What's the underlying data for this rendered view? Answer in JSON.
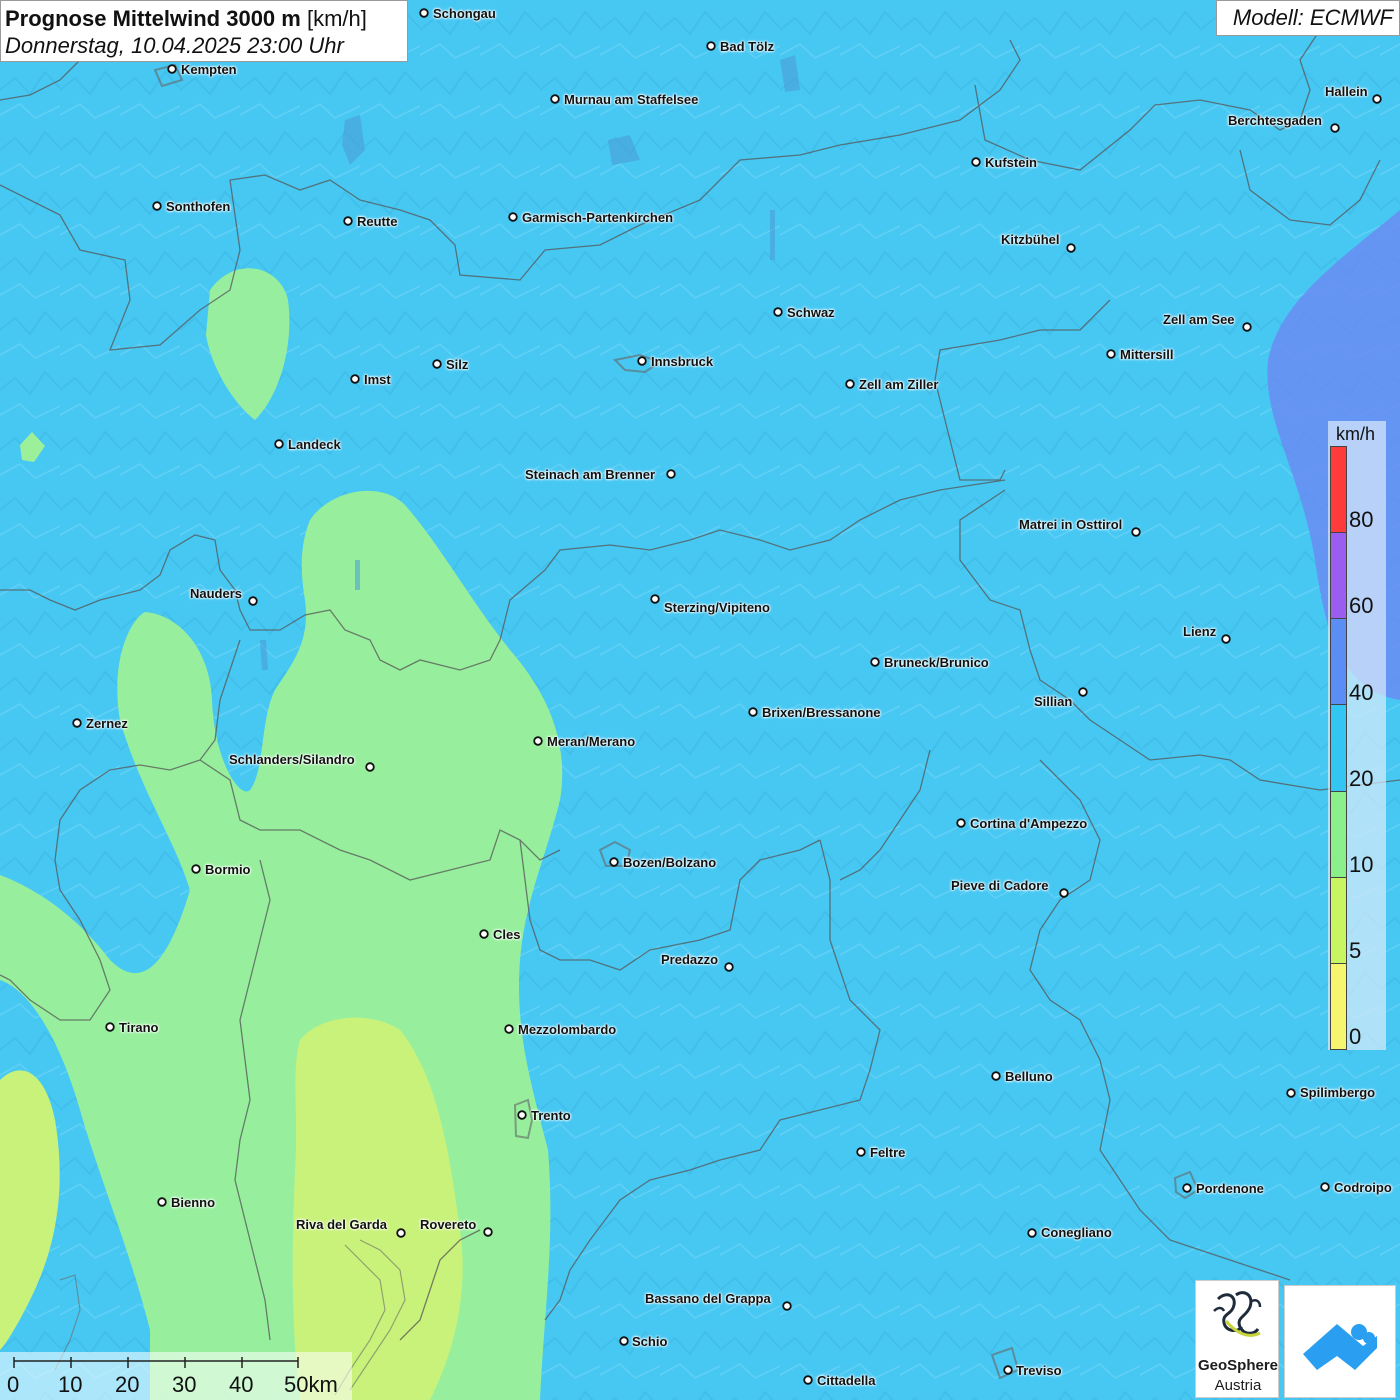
{
  "title": {
    "main": "Prognose Mittelwind 3000 m",
    "unit": "[km/h]",
    "datetime": "Donnerstag, 10.04.2025 23:00 Uhr"
  },
  "model": "Modell: ECMWF",
  "places": [
    {
      "name": "Schongau"
    },
    {
      "name": "Bad Tölz"
    },
    {
      "name": "Kempten"
    },
    {
      "name": "Murnau am Staffelsee"
    },
    {
      "name": "Hallein"
    },
    {
      "name": "Berchtesgaden"
    },
    {
      "name": "Kufstein"
    },
    {
      "name": "Sonthofen"
    },
    {
      "name": "Reutte"
    },
    {
      "name": "Garmisch-Partenkirchen"
    },
    {
      "name": "Kitzbühel"
    },
    {
      "name": "Schwaz"
    },
    {
      "name": "Zell am See"
    },
    {
      "name": "Innsbruck"
    },
    {
      "name": "Mittersill"
    },
    {
      "name": "Imst"
    },
    {
      "name": "Silz"
    },
    {
      "name": "Zell am Ziller"
    },
    {
      "name": "Landeck"
    },
    {
      "name": "Steinach am Brenner"
    },
    {
      "name": "Matrei in Osttirol"
    },
    {
      "name": "Nauders"
    },
    {
      "name": "Sterzing/Vipiteno"
    },
    {
      "name": "Lienz"
    },
    {
      "name": "Bruneck/Brunico"
    },
    {
      "name": "Sillian"
    },
    {
      "name": "Brixen/Bressanone"
    },
    {
      "name": "Zernez"
    },
    {
      "name": "Meran/Merano"
    },
    {
      "name": "Schlanders/Silandro"
    },
    {
      "name": "Cortina d'Ampezzo"
    },
    {
      "name": "Bozen/Bolzano"
    },
    {
      "name": "Bormio"
    },
    {
      "name": "Pieve di Cadore"
    },
    {
      "name": "Cles"
    },
    {
      "name": "Predazzo"
    },
    {
      "name": "Tirano"
    },
    {
      "name": "Mezzolombardo"
    },
    {
      "name": "Belluno"
    },
    {
      "name": "Spilimbergo"
    },
    {
      "name": "Trento"
    },
    {
      "name": "Feltre"
    },
    {
      "name": "Pordenone"
    },
    {
      "name": "Codroipo"
    },
    {
      "name": "Bienno"
    },
    {
      "name": "Riva del Garda"
    },
    {
      "name": "Rovereto"
    },
    {
      "name": "Conegliano"
    },
    {
      "name": "Bassano del Grappa"
    },
    {
      "name": "Schio"
    },
    {
      "name": "Treviso"
    },
    {
      "name": "Cittadella"
    }
  ],
  "legend": {
    "unit": "km/h",
    "labels": [
      "80",
      "60",
      "40",
      "20",
      "10",
      "5",
      "0"
    ],
    "colors": [
      "#ff3b3b",
      "#9b5cf0",
      "#5b8ef5",
      "#34c6f2",
      "#8cf08a",
      "#c8f562",
      "#f5f56e"
    ]
  },
  "scale": {
    "labels": [
      "0",
      "10",
      "20",
      "30",
      "40",
      "50km"
    ]
  },
  "logo": {
    "name_line1": "GeoSphere",
    "name_line2": "Austria"
  },
  "colors": {
    "background_wind": "#45c9f3",
    "low_wind": "#9af09a",
    "very_low_wind": "#c8f07a",
    "high_wind": "#6a8ef0"
  }
}
